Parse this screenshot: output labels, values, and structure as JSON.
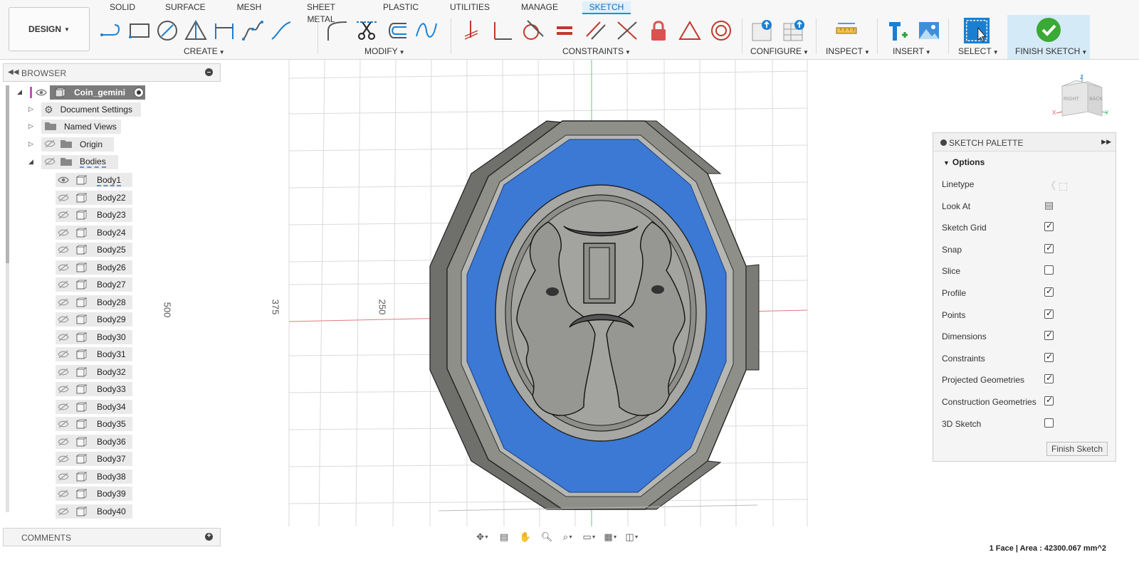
{
  "toolbar": {
    "workspace_label": "DESIGN",
    "tabs": [
      "SOLID",
      "SURFACE",
      "MESH",
      "SHEET METAL",
      "PLASTIC",
      "UTILITIES",
      "MANAGE",
      "SKETCH"
    ],
    "active_tab": "SKETCH",
    "groups": {
      "create": "CREATE",
      "modify": "MODIFY",
      "constraints": "CONSTRAINTS",
      "configure": "CONFIGURE",
      "inspect": "INSPECT",
      "insert": "INSERT",
      "select": "SELECT",
      "finish": "FINISH SKETCH"
    },
    "icons": {
      "create": [
        "line-icon",
        "rectangle-icon",
        "circle-icon",
        "polygon-icon",
        "dimension-icon",
        "spline-icon",
        "conic-curve-icon"
      ],
      "modify": [
        "fillet-icon",
        "trim-icon",
        "offset-icon",
        "sketch-curve-icon"
      ],
      "constraints": [
        "horizontal-vertical-icon",
        "perpendicular-icon",
        "tangent-icon",
        "equal-icon",
        "parallel-icon",
        "collinear-icon",
        "fix-icon",
        "symmetry-icon",
        "concentric-icon"
      ],
      "configure": [
        "parameters-icon",
        "configure-table-icon"
      ],
      "inspect": [
        "measure-icon"
      ],
      "insert": [
        "insert-mcmaster-icon",
        "insert-image-icon"
      ],
      "select": [
        "select-icon"
      ],
      "finish": [
        "finish-sketch-check-icon"
      ]
    }
  },
  "browser": {
    "title": "BROWSER",
    "root": "Coin_gemini",
    "items": [
      {
        "label": "Document Settings",
        "type": "settings"
      },
      {
        "label": "Named Views",
        "type": "folder"
      },
      {
        "label": "Origin",
        "type": "folder"
      },
      {
        "label": "Bodies",
        "type": "folder"
      }
    ],
    "bodies": [
      "Body1",
      "Body22",
      "Body23",
      "Body24",
      "Body25",
      "Body26",
      "Body27",
      "Body28",
      "Body29",
      "Body30",
      "Body31",
      "Body32",
      "Body33",
      "Body34",
      "Body35",
      "Body36",
      "Body37",
      "Body38",
      "Body39",
      "Body40"
    ]
  },
  "comments": {
    "title": "COMMENTS"
  },
  "canvas": {
    "dimension_labels": [
      "500",
      "375",
      "250"
    ],
    "axis_x_color": "#e07b7b",
    "axis_y_color": "#5fcf7a",
    "face_color": "#3b79d4",
    "coin_color": "#8f8f8a"
  },
  "viewcube": {
    "top": "Z",
    "left": "X",
    "right": "Y",
    "face_right": "RIGHT",
    "face_back": "BACK"
  },
  "palette": {
    "title": "SKETCH PALETTE",
    "section": "Options",
    "rows": [
      {
        "label": "Linetype",
        "kind": "linetype"
      },
      {
        "label": "Look At",
        "kind": "lookat"
      },
      {
        "label": "Sketch Grid",
        "checked": true
      },
      {
        "label": "Snap",
        "checked": true
      },
      {
        "label": "Slice",
        "checked": false
      },
      {
        "label": "Profile",
        "checked": true
      },
      {
        "label": "Points",
        "checked": true
      },
      {
        "label": "Dimensions",
        "checked": true
      },
      {
        "label": "Constraints",
        "checked": true
      },
      {
        "label": "Projected Geometries",
        "checked": true
      },
      {
        "label": "Construction Geometries",
        "checked": true
      },
      {
        "label": "3D Sketch",
        "checked": false
      }
    ],
    "finish_button": "Finish Sketch"
  },
  "status": {
    "text": "1 Face | Area : 42300.067 mm^2"
  }
}
